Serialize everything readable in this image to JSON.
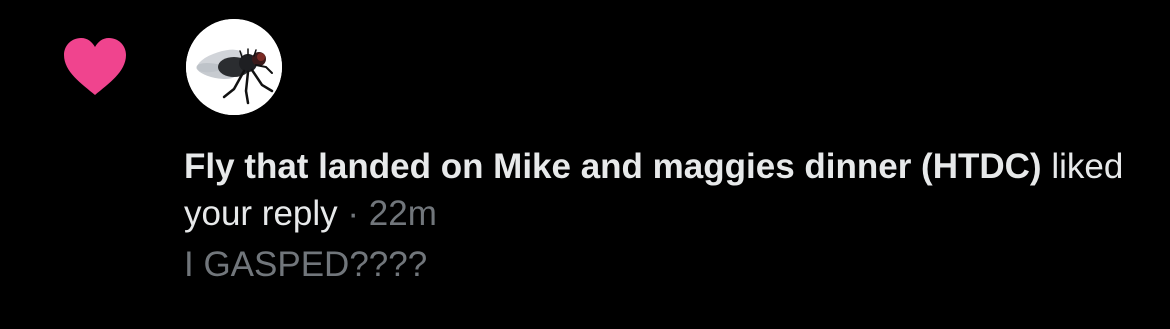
{
  "notification": {
    "type": "like",
    "icon": "heart-icon",
    "heart_color": "#f0448e",
    "avatar": "fly-avatar-icon",
    "actor_name": "Fly that landed on Mike and maggies dinner (HTDC)",
    "action": "liked your reply",
    "separator": "·",
    "time": "22m",
    "reply_text": "I GASPED????"
  }
}
